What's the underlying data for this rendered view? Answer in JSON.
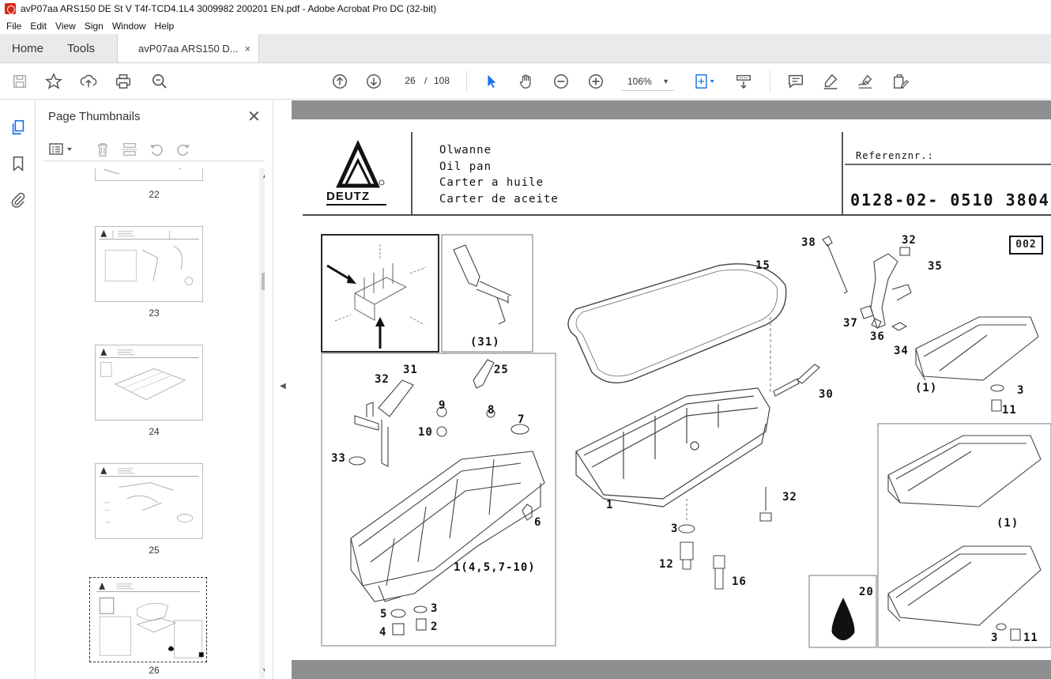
{
  "window": {
    "title": "avP07aa ARS150 DE St V T4f-TCD4.1L4 3009982 200201 EN.pdf - Adobe Acrobat Pro DC (32-bit)"
  },
  "menu": [
    "File",
    "Edit",
    "View",
    "Sign",
    "Window",
    "Help"
  ],
  "tabs": {
    "home": "Home",
    "tools": "Tools",
    "document": "avP07aa ARS150 D...",
    "close": "×"
  },
  "toolbar": {
    "current_page": "26",
    "page_separator": "/",
    "total_pages": "108",
    "zoom": "106%",
    "icons": [
      "save-icon",
      "bookmark-star-icon",
      "upload-icon",
      "print-icon",
      "search-zoom-icon",
      "page-up-icon",
      "page-down-icon",
      "select-cursor-icon",
      "hand-icon",
      "zoom-out-icon",
      "zoom-in-icon",
      "fit-page-icon",
      "scroll-mode-icon",
      "comment-icon",
      "highlight-icon",
      "sign-icon",
      "edit-sign-icon"
    ]
  },
  "panel": {
    "title": "Page Thumbnails",
    "close": "✕",
    "thumbnails": [
      {
        "label": "22"
      },
      {
        "label": "23"
      },
      {
        "label": "24"
      },
      {
        "label": "25"
      },
      {
        "label": "26",
        "selected": true
      }
    ]
  },
  "document": {
    "logo_text": "DEUTZ",
    "titles": [
      "Olwanne",
      "Oil pan",
      "Carter a huile",
      "Carter de aceite"
    ],
    "ref_label": "Referenznr.:",
    "ref_number": "0128-02- 0510 3804",
    "code": "002",
    "part_numbers": [
      "38",
      "32",
      "35",
      "15",
      "37",
      "36",
      "34",
      "(1)",
      "3",
      "11",
      "30",
      "(31)",
      "31",
      "25",
      "32",
      "9",
      "8",
      "7",
      "10",
      "33",
      "6",
      "1",
      "32",
      "3",
      "12",
      "16",
      "1(4,5,7-10)",
      "5",
      "3",
      "4",
      "2",
      "(1)",
      "20",
      "3",
      "11"
    ]
  }
}
